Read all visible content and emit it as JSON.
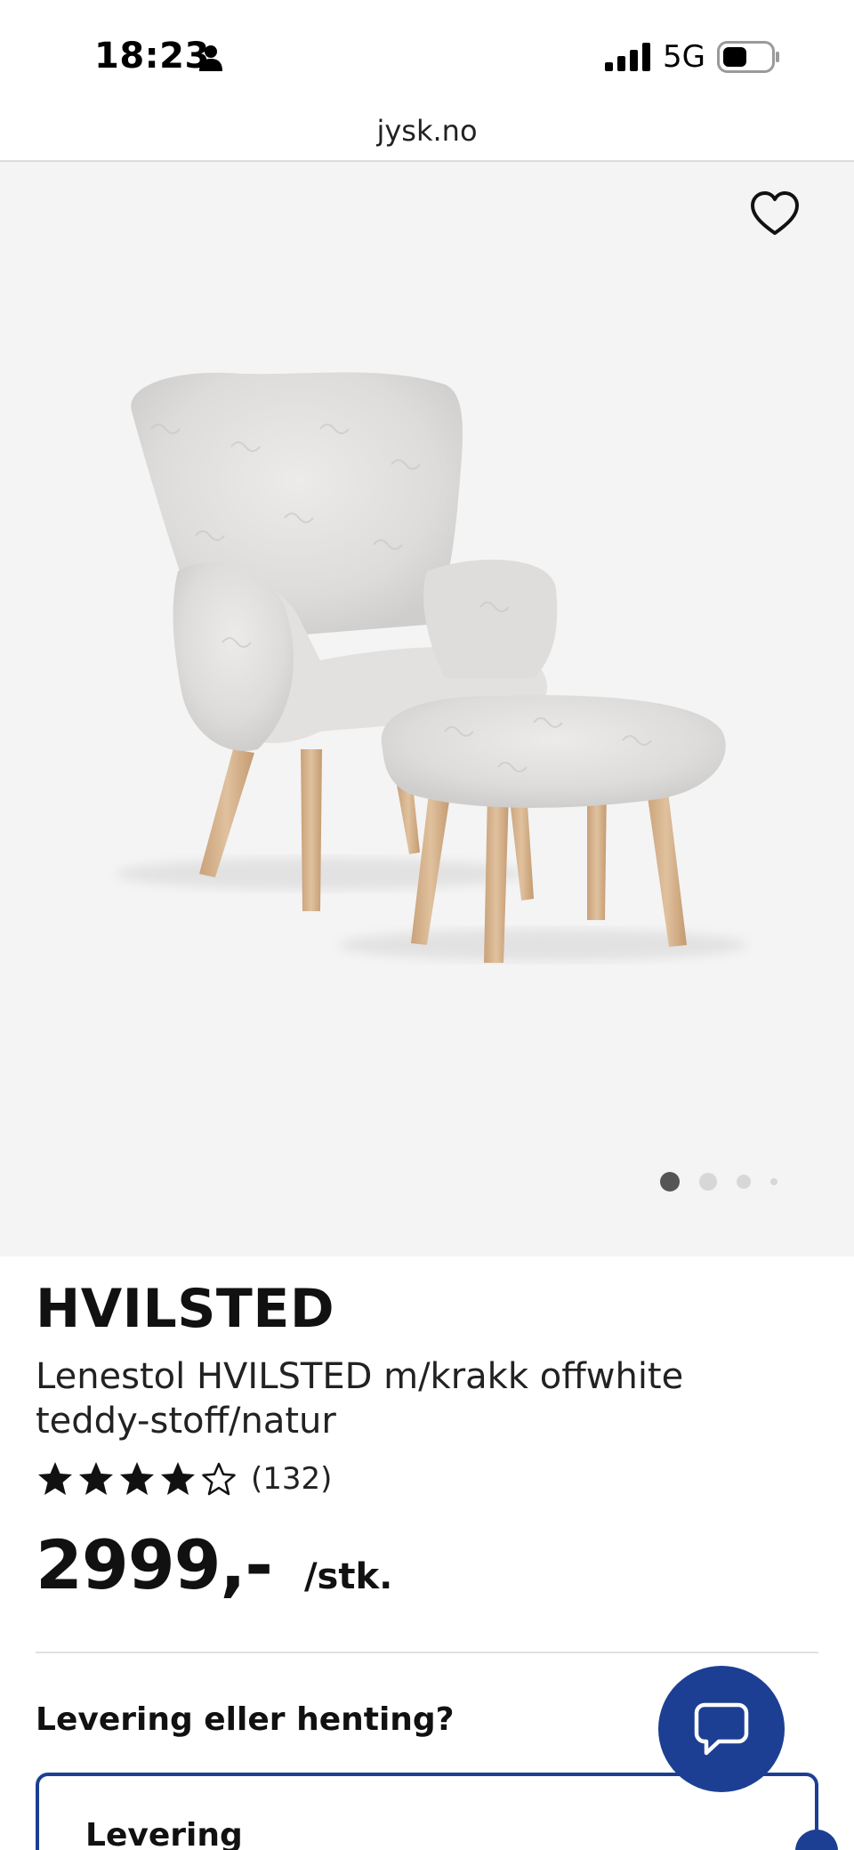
{
  "status_bar": {
    "time": "18:23",
    "network": "5G",
    "icons": [
      "person-icon",
      "signal-icon",
      "battery-icon"
    ]
  },
  "browser": {
    "url": "jysk.no"
  },
  "gallery": {
    "image_alt": "chair-with-footstool-image",
    "favorite_icon": "heart-icon",
    "slides_total": 4,
    "active_slide": 1
  },
  "product": {
    "brand": "HVILSTED",
    "description": "Lenestol HVILSTED m/krakk offwhite teddy-stoff/natur",
    "rating_stars": 4,
    "rating_max": 5,
    "review_count": "(132)",
    "price": "2999,-",
    "unit": "/stk."
  },
  "delivery": {
    "heading": "Levering eller henting?",
    "option_label": "Levering"
  },
  "chat": {
    "icon": "chat-bubble-icon"
  },
  "colors": {
    "accent": "#1c3f94",
    "gallery_bg": "#f4f4f4",
    "text": "#111111"
  }
}
